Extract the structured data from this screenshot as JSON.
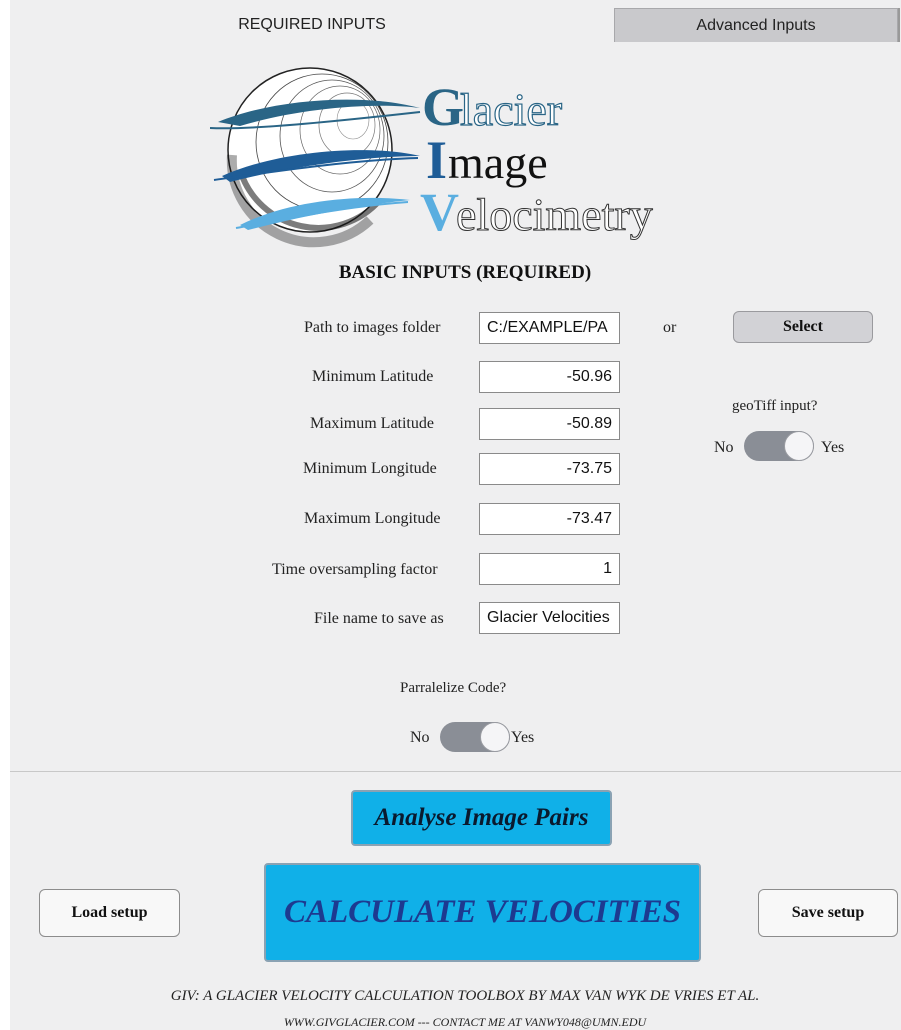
{
  "tabs": {
    "required": "REQUIRED INPUTS",
    "advanced": "Advanced Inputs"
  },
  "logo": {
    "line1_initial": "G",
    "line1_rest": "lacier",
    "line2_initial": "I",
    "line2_rest": "mage",
    "line3_initial": "V",
    "line3_rest": "elocimetry"
  },
  "section_title": "BASIC INPUTS (REQUIRED)",
  "inputs": {
    "path": {
      "label": "Path to images folder",
      "value": "C:/EXAMPLE/PA"
    },
    "min_lat": {
      "label": "Minimum Latitude",
      "value": "-50.96"
    },
    "max_lat": {
      "label": "Maximum Latitude",
      "value": "-50.89"
    },
    "min_lon": {
      "label": "Minimum Longitude",
      "value": "-73.75"
    },
    "max_lon": {
      "label": "Maximum Longitude",
      "value": "-73.47"
    },
    "oversample": {
      "label": "Time oversampling factor",
      "value": "1"
    },
    "filename": {
      "label": "File name to save as",
      "value": "Glacier Velocities"
    }
  },
  "or_label": "or",
  "select_label": "Select",
  "geotiff": {
    "label": "geoTiff input?",
    "no": "No",
    "yes": "Yes"
  },
  "parallel": {
    "label": "Parralelize Code?",
    "no": "No",
    "yes": "Yes"
  },
  "buttons": {
    "analyse": "Analyse Image Pairs",
    "calculate": "CALCULATE VELOCITIES",
    "load": "Load setup",
    "save": "Save setup"
  },
  "footer": {
    "line1": "GIV: A GLACIER VELOCITY CALCULATION TOOLBOX BY MAX VAN WYK DE VRIES ET AL.",
    "line2": "WWW.GIVGLACIER.COM --- CONTACT ME AT VANWY048@UMN.EDU"
  },
  "colors": {
    "accent_blue": "#10b0e8",
    "logo_dark": "#2a6586",
    "logo_mid": "#1f5d97",
    "logo_light": "#5aaee0"
  }
}
